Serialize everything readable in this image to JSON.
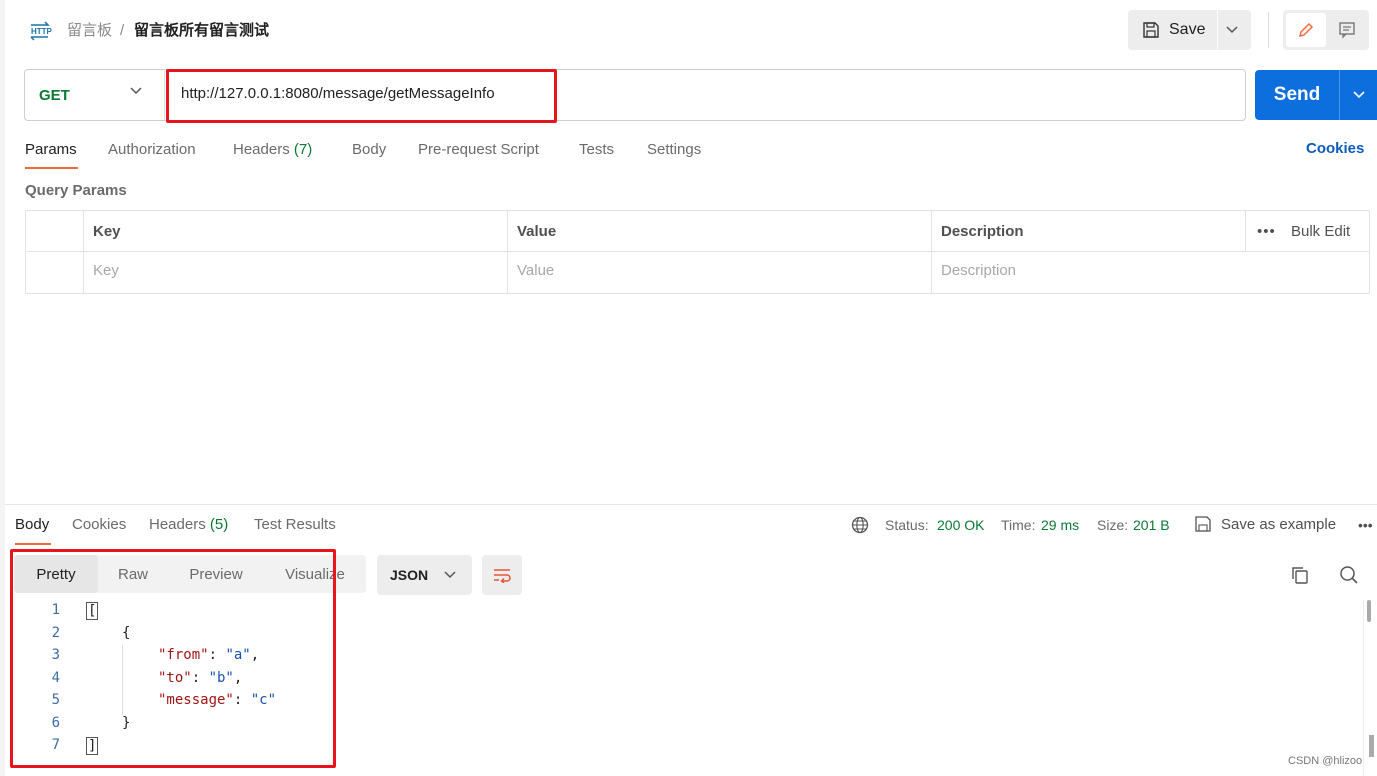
{
  "header": {
    "collection": "留言板",
    "separator": "/",
    "request_name": "留言板所有留言测试",
    "save_label": "Save"
  },
  "request": {
    "method": "GET",
    "url": "http://127.0.0.1:8080/message/getMessageInfo",
    "send_label": "Send"
  },
  "request_tabs": {
    "params": "Params",
    "authorization": "Authorization",
    "headers": "Headers",
    "headers_count": "(7)",
    "body": "Body",
    "prerequest": "Pre-request Script",
    "tests": "Tests",
    "settings": "Settings",
    "cookies": "Cookies"
  },
  "query_params": {
    "title": "Query Params",
    "columns": [
      "Key",
      "Value",
      "Description"
    ],
    "bulk_edit": "Bulk Edit",
    "more": "•••",
    "placeholders": [
      "Key",
      "Value",
      "Description"
    ]
  },
  "response_tabs": {
    "body": "Body",
    "cookies": "Cookies",
    "headers": "Headers",
    "headers_count": "(5)",
    "test_results": "Test Results"
  },
  "response_meta": {
    "status_label": "Status:",
    "status_value": "200 OK",
    "time_label": "Time:",
    "time_value": "29 ms",
    "size_label": "Size:",
    "size_value": "201 B",
    "save_example": "Save as example",
    "more": "•••"
  },
  "view_modes": [
    "Pretty",
    "Raw",
    "Preview",
    "Visualize"
  ],
  "format": "JSON",
  "code_lines": [
    {
      "n": "1",
      "text": "["
    },
    {
      "n": "2",
      "text": "{"
    },
    {
      "n": "3",
      "key": "\"from\"",
      "val": "\"a\"",
      "tail": ","
    },
    {
      "n": "4",
      "key": "\"to\"",
      "val": "\"b\"",
      "tail": ","
    },
    {
      "n": "5",
      "key": "\"message\"",
      "val": "\"c\"",
      "tail": ""
    },
    {
      "n": "6",
      "text": "}"
    },
    {
      "n": "7",
      "text": "]"
    }
  ],
  "watermark": "CSDN @hlizoo",
  "colors": {
    "accent": "#f26b3a",
    "send": "#0d6fde",
    "method": "#0a7a33",
    "highlight": "#e8151b"
  }
}
